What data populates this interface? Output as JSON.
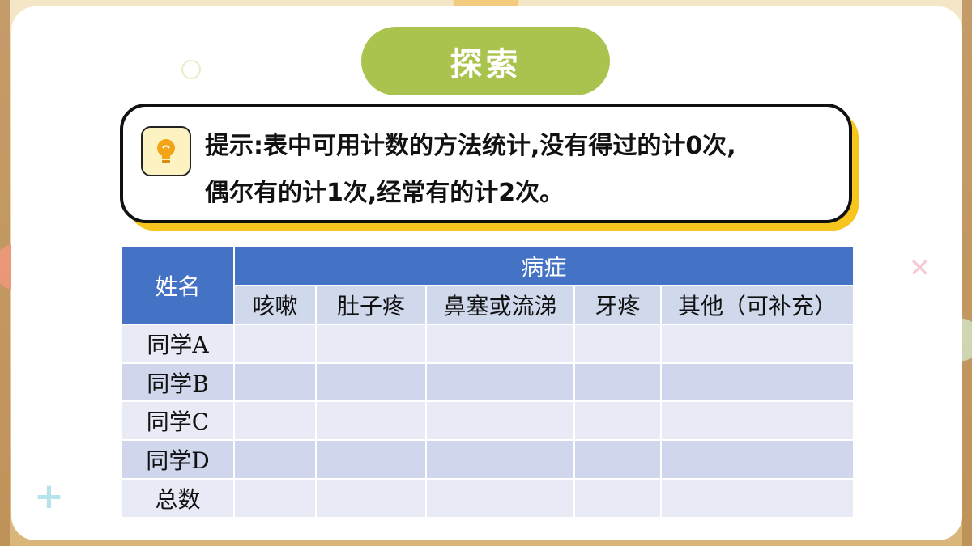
{
  "title": "探索",
  "hint": {
    "line1": "提示:表中可用计数的方法统计,没有得过的计0次,",
    "line2": "偶尔有的计1次,经常有的计2次。",
    "icon": "lightbulb-icon"
  },
  "table": {
    "name_header": "姓名",
    "group_header": "病症",
    "columns": [
      "咳嗽",
      "肚子疼",
      "鼻塞或流涕",
      "牙疼",
      "其他（可补充）"
    ],
    "rows": [
      {
        "label": "同学A",
        "cells": [
          "",
          "",
          "",
          "",
          ""
        ]
      },
      {
        "label": "同学B",
        "cells": [
          "",
          "",
          "",
          "",
          ""
        ]
      },
      {
        "label": "同学C",
        "cells": [
          "",
          "",
          "",
          "",
          ""
        ]
      },
      {
        "label": "同学D",
        "cells": [
          "",
          "",
          "",
          "",
          ""
        ]
      },
      {
        "label": "总数",
        "cells": [
          "",
          "",
          "",
          "",
          ""
        ]
      }
    ]
  },
  "colors": {
    "title_pill": "#a9c34e",
    "header_blue": "#4472c4",
    "hint_shadow": "#f6c51e"
  }
}
